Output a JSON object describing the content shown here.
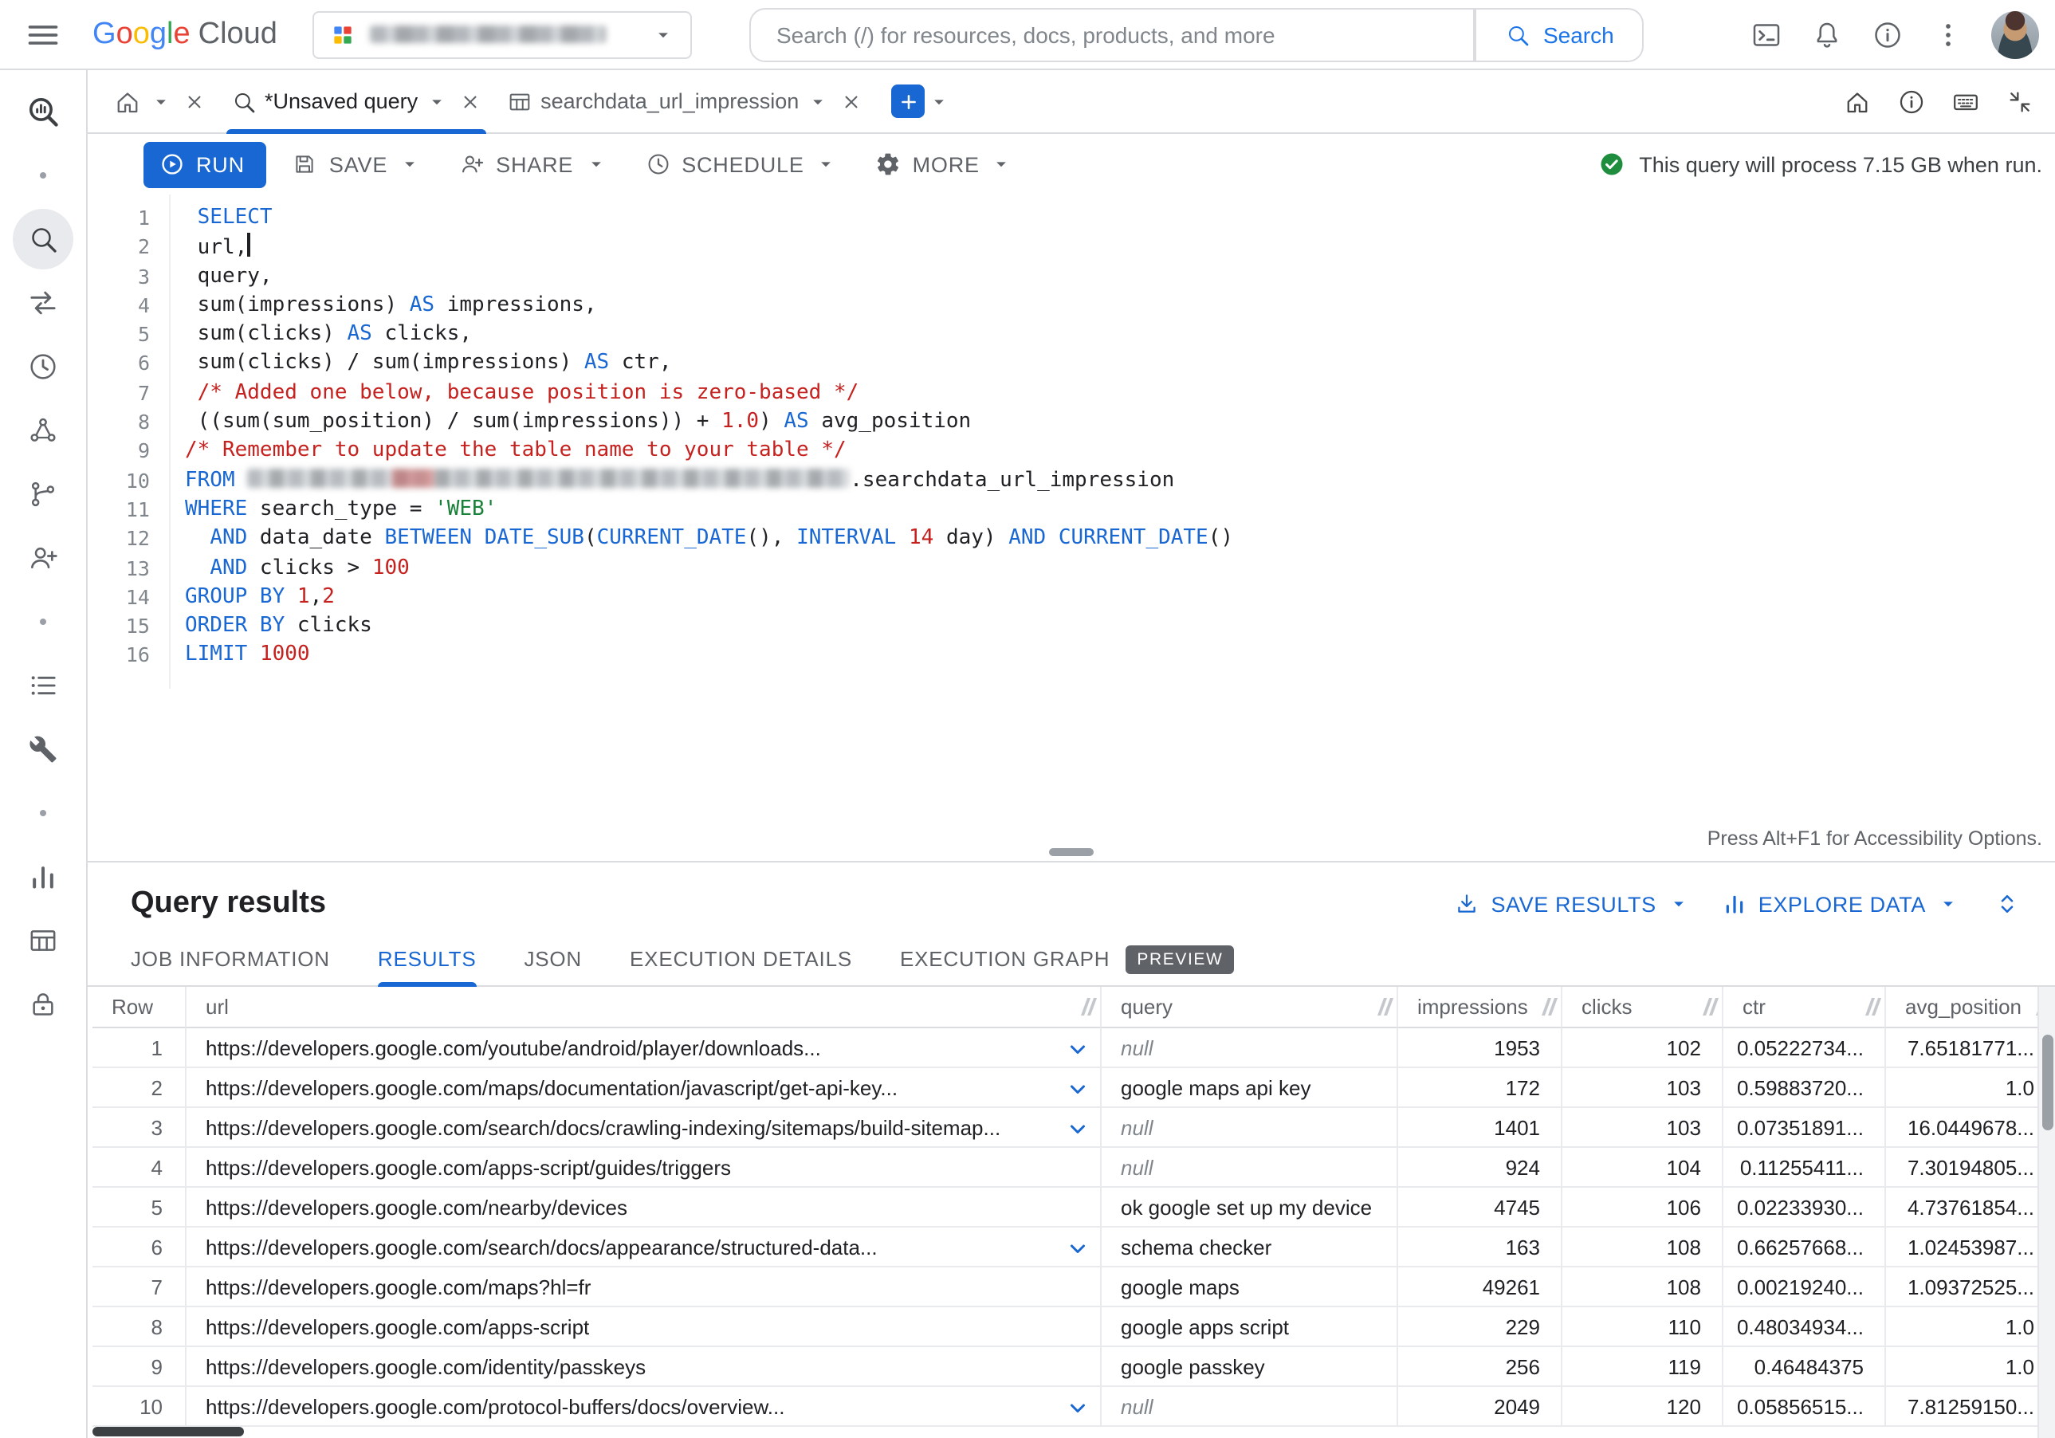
{
  "colors": {
    "accent_blue": "#1967d2",
    "run_button_blue": "#1967d2",
    "success_green": "#1e8e3e",
    "keyword_blue": "#1967d2",
    "literal_red": "#c5221f",
    "string_green": "#188038",
    "preview_badge_bg": "#5f6368"
  },
  "header": {
    "logo": {
      "google": "Google",
      "cloud": "Cloud"
    },
    "project_selector": {
      "redacted": true
    },
    "search": {
      "placeholder": "Search (/) for resources, docs, products, and more",
      "button_label": "Search"
    },
    "icons": [
      "menu-icon",
      "project-icon",
      "cloud-shell-icon",
      "notifications-icon",
      "help-icon",
      "more-vert-icon",
      "avatar"
    ]
  },
  "sidebar": {
    "icons": [
      "bigquery-logo",
      "sql-workspace-icon",
      "data-transfers-icon",
      "scheduled-queries-icon",
      "analytics-hub-icon",
      "dataform-icon",
      "sharing-icon",
      "reservations-icon",
      "admin-icon",
      "bi-engine-icon",
      "datasets-icon",
      "governance-icon"
    ]
  },
  "tabbar": {
    "tabs": [
      {
        "type": "home"
      },
      {
        "type": "query",
        "label": "*Unsaved query",
        "active": true
      },
      {
        "type": "table",
        "label": "searchdata_url_impression",
        "active": false
      }
    ],
    "right_icons": [
      "home-icon",
      "info-icon",
      "keyboard-icon",
      "collapse-icon"
    ]
  },
  "toolbar": {
    "run_label": "RUN",
    "save_label": "SAVE",
    "share_label": "SHARE",
    "schedule_label": "SCHEDULE",
    "more_label": "MORE",
    "process_message": "This query will process 7.15 GB when run."
  },
  "editor": {
    "accessibility_note": "Press Alt+F1 for Accessibility Options.",
    "lines": [
      [
        {
          "t": " ",
          "c": "pl"
        },
        {
          "t": "SELECT",
          "c": "kw"
        }
      ],
      [
        {
          "t": " url,",
          "c": "pl"
        },
        {
          "t": "",
          "c": "cursor"
        }
      ],
      [
        {
          "t": " query,",
          "c": "pl"
        }
      ],
      [
        {
          "t": " sum(impressions) ",
          "c": "pl"
        },
        {
          "t": "AS",
          "c": "kw"
        },
        {
          "t": " impressions,",
          "c": "pl"
        }
      ],
      [
        {
          "t": " sum(clicks) ",
          "c": "pl"
        },
        {
          "t": "AS",
          "c": "kw"
        },
        {
          "t": " clicks,",
          "c": "pl"
        }
      ],
      [
        {
          "t": " sum(clicks) / sum(impressions) ",
          "c": "pl"
        },
        {
          "t": "AS",
          "c": "kw"
        },
        {
          "t": " ctr,",
          "c": "pl"
        }
      ],
      [
        {
          "t": " ",
          "c": "pl"
        },
        {
          "t": "/* Added one below, because position is zero-based */",
          "c": "cm"
        }
      ],
      [
        {
          "t": " ((sum(sum_position) / sum(impressions)) + ",
          "c": "pl"
        },
        {
          "t": "1.0",
          "c": "num"
        },
        {
          "t": ") ",
          "c": "pl"
        },
        {
          "t": "AS",
          "c": "kw"
        },
        {
          "t": " avg_position",
          "c": "pl"
        }
      ],
      [
        {
          "t": "/* Remember to update the table name to your table */",
          "c": "cm"
        }
      ],
      [
        {
          "t": "FROM",
          "c": "kw"
        },
        {
          "t": " ",
          "c": "pl"
        },
        {
          "t": "",
          "c": "redact"
        },
        {
          "t": ".searchdata_url_impression",
          "c": "pl"
        }
      ],
      [
        {
          "t": "WHERE",
          "c": "kw"
        },
        {
          "t": " search_type = ",
          "c": "pl"
        },
        {
          "t": "'WEB'",
          "c": "str"
        }
      ],
      [
        {
          "t": "  ",
          "c": "pl"
        },
        {
          "t": "AND",
          "c": "kw"
        },
        {
          "t": " data_date ",
          "c": "pl"
        },
        {
          "t": "BETWEEN",
          "c": "kw"
        },
        {
          "t": " ",
          "c": "pl"
        },
        {
          "t": "DATE_SUB",
          "c": "fn"
        },
        {
          "t": "(",
          "c": "pl"
        },
        {
          "t": "CURRENT_DATE",
          "c": "fn"
        },
        {
          "t": "(), ",
          "c": "pl"
        },
        {
          "t": "INTERVAL",
          "c": "kw"
        },
        {
          "t": " ",
          "c": "pl"
        },
        {
          "t": "14",
          "c": "num"
        },
        {
          "t": " day) ",
          "c": "pl"
        },
        {
          "t": "AND",
          "c": "kw"
        },
        {
          "t": " ",
          "c": "pl"
        },
        {
          "t": "CURRENT_DATE",
          "c": "fn"
        },
        {
          "t": "()",
          "c": "pl"
        }
      ],
      [
        {
          "t": "  ",
          "c": "pl"
        },
        {
          "t": "AND",
          "c": "kw"
        },
        {
          "t": " clicks > ",
          "c": "pl"
        },
        {
          "t": "100",
          "c": "num"
        }
      ],
      [
        {
          "t": "GROUP BY",
          "c": "kw"
        },
        {
          "t": " ",
          "c": "pl"
        },
        {
          "t": "1",
          "c": "num"
        },
        {
          "t": ",",
          "c": "pl"
        },
        {
          "t": "2",
          "c": "num"
        }
      ],
      [
        {
          "t": "ORDER BY",
          "c": "kw"
        },
        {
          "t": " clicks",
          "c": "pl"
        }
      ],
      [
        {
          "t": "LIMIT",
          "c": "kw"
        },
        {
          "t": " ",
          "c": "pl"
        },
        {
          "t": "1000",
          "c": "num"
        }
      ]
    ]
  },
  "results": {
    "title": "Query results",
    "actions": {
      "save_results": "SAVE RESULTS",
      "explore_data": "EXPLORE DATA"
    },
    "tabs": [
      {
        "label": "JOB INFORMATION"
      },
      {
        "label": "RESULTS",
        "active": true
      },
      {
        "label": "JSON"
      },
      {
        "label": "EXECUTION DETAILS"
      },
      {
        "label": "EXECUTION GRAPH",
        "badge": "PREVIEW"
      }
    ],
    "columns": [
      "Row",
      "url",
      "query",
      "impressions",
      "clicks",
      "ctr",
      "avg_position"
    ],
    "null_display": "null",
    "rows": [
      {
        "row": "1",
        "url": "https://developers.google.com/youtube/android/player/downloads...",
        "expandable": true,
        "query": null,
        "impressions": "1953",
        "clicks": "102",
        "ctr": "0.05222734...",
        "avg_position": "7.65181771..."
      },
      {
        "row": "2",
        "url": "https://developers.google.com/maps/documentation/javascript/get-api-key...",
        "expandable": true,
        "query": "google maps api key",
        "impressions": "172",
        "clicks": "103",
        "ctr": "0.59883720...",
        "avg_position": "1.0"
      },
      {
        "row": "3",
        "url": "https://developers.google.com/search/docs/crawling-indexing/sitemaps/build-sitemap...",
        "expandable": true,
        "query": null,
        "impressions": "1401",
        "clicks": "103",
        "ctr": "0.07351891...",
        "avg_position": "16.0449678..."
      },
      {
        "row": "4",
        "url": "https://developers.google.com/apps-script/guides/triggers",
        "expandable": false,
        "query": null,
        "impressions": "924",
        "clicks": "104",
        "ctr": "0.11255411...",
        "avg_position": "7.30194805..."
      },
      {
        "row": "5",
        "url": "https://developers.google.com/nearby/devices",
        "expandable": false,
        "query": "ok google set up my device",
        "impressions": "4745",
        "clicks": "106",
        "ctr": "0.02233930...",
        "avg_position": "4.73761854..."
      },
      {
        "row": "6",
        "url": "https://developers.google.com/search/docs/appearance/structured-data...",
        "expandable": true,
        "query": "schema checker",
        "impressions": "163",
        "clicks": "108",
        "ctr": "0.66257668...",
        "avg_position": "1.02453987..."
      },
      {
        "row": "7",
        "url": "https://developers.google.com/maps?hl=fr",
        "expandable": false,
        "query": "google maps",
        "impressions": "49261",
        "clicks": "108",
        "ctr": "0.00219240...",
        "avg_position": "1.09372525..."
      },
      {
        "row": "8",
        "url": "https://developers.google.com/apps-script",
        "expandable": false,
        "query": "google apps script",
        "impressions": "229",
        "clicks": "110",
        "ctr": "0.48034934...",
        "avg_position": "1.0"
      },
      {
        "row": "9",
        "url": "https://developers.google.com/identity/passkeys",
        "expandable": false,
        "query": "google passkey",
        "impressions": "256",
        "clicks": "119",
        "ctr": "0.46484375",
        "avg_position": "1.0"
      },
      {
        "row": "10",
        "url": "https://developers.google.com/protocol-buffers/docs/overview...",
        "expandable": true,
        "query": null,
        "impressions": "2049",
        "clicks": "120",
        "ctr": "0.05856515...",
        "avg_position": "7.81259150..."
      }
    ]
  }
}
